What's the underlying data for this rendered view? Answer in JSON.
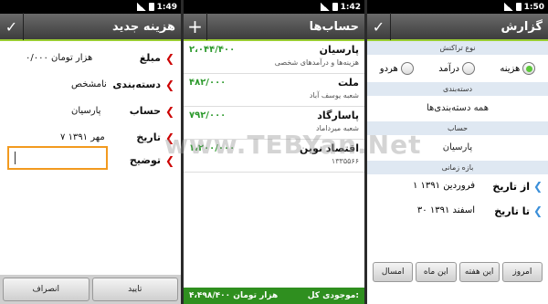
{
  "watermark": "www.TEBYan.Net",
  "screen1": {
    "time": "1:49",
    "title": "هزینه جدید",
    "fields": [
      {
        "label": "مبلغ",
        "value": "۰/۰۰۰  هزار تومان"
      },
      {
        "label": "دسته‌بندی",
        "value": "نامشخص"
      },
      {
        "label": "حساب",
        "value": "پارسیان"
      },
      {
        "label": "تاریخ",
        "value": "۷ مهر ۱۳۹۱"
      },
      {
        "label": "توضیح",
        "value": ""
      }
    ],
    "confirm_label": "تایید",
    "cancel_label": "انصراف"
  },
  "screen2": {
    "time": "1:42",
    "title": "حساب‌ها",
    "accounts": [
      {
        "name": "پارسیان",
        "sub": "هزینه‌ها و درآمدهای شخصی",
        "amount": "۲،۰۴۴/۴۰۰"
      },
      {
        "name": "ملت",
        "sub": "شعبه یوسف آباد",
        "amount": "۴۸۲/۰۰۰"
      },
      {
        "name": "پاسارگاد",
        "sub": "شعبه میرداماد",
        "amount": "۷۹۲/۰۰۰"
      },
      {
        "name": "اقتصاد نوین",
        "sub": "۱۳۳۵۵۶۶",
        "amount": "۱،۲۰۰/۰۰۰"
      }
    ],
    "footer_label": "موجودی کل:",
    "footer_value": "۴،۴۹۸/۴۰۰  هزار تومان"
  },
  "screen3": {
    "time": "1:50",
    "title": "گزارش",
    "type_head": "نوع تراکنش",
    "radios": [
      {
        "label": "هزینه",
        "selected": true
      },
      {
        "label": "درآمد",
        "selected": false
      },
      {
        "label": "هردو",
        "selected": false
      }
    ],
    "category_head": "دسته‌بندی",
    "category_value": "همه دسته‌بندی‌ها",
    "account_head": "حساب",
    "account_value": "پارسیان",
    "period_head": "بازه زمانی",
    "from_label": "از تاریخ",
    "from_value": "۱ فروردین ۱۳۹۱",
    "to_label": "تا تاریخ",
    "to_value": "۳۰ اسفند ۱۳۹۱",
    "buttons": [
      "امروز",
      "این هفته",
      "این ماه",
      "امسال"
    ]
  }
}
